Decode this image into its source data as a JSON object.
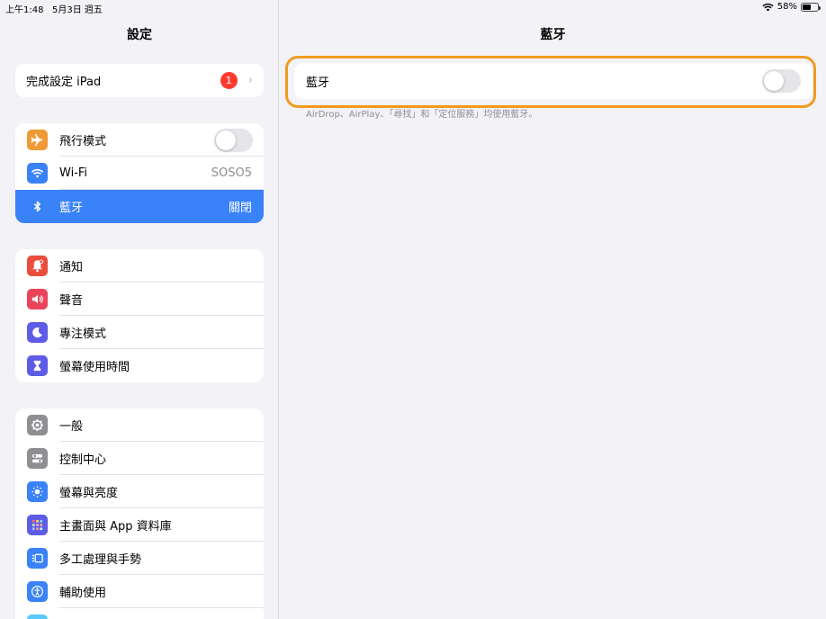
{
  "status": {
    "time": "上午1:48",
    "date": "5月3日 週五",
    "battery": "58%",
    "battery_level": 0.58
  },
  "sidebar": {
    "title": "設定",
    "setup": {
      "label": "完成設定 iPad",
      "badge": "1"
    },
    "group1": [
      {
        "label": "飛行模式",
        "icon": "airplane-icon",
        "color": "#f09a37",
        "control": "toggle",
        "on": false
      },
      {
        "label": "Wi-Fi",
        "icon": "wifi-icon",
        "color": "#3a82f7",
        "value": "SOSO5"
      },
      {
        "label": "藍牙",
        "icon": "bluetooth-icon",
        "color": "#3a82f7",
        "value": "關閉",
        "selected": true
      }
    ],
    "group2": [
      {
        "label": "通知",
        "icon": "notification-icon",
        "color": "#eb4d3d"
      },
      {
        "label": "聲音",
        "icon": "speaker-icon",
        "color": "#eb445a"
      },
      {
        "label": "專注模式",
        "icon": "moon-icon",
        "color": "#5e5ce6"
      },
      {
        "label": "螢幕使用時間",
        "icon": "hourglass-icon",
        "color": "#5e5ce6"
      }
    ],
    "group3": [
      {
        "label": "一般",
        "icon": "gear-icon",
        "color": "#8e8e93"
      },
      {
        "label": "控制中心",
        "icon": "switches-icon",
        "color": "#8e8e93"
      },
      {
        "label": "螢幕與亮度",
        "icon": "sun-icon",
        "color": "#3a82f7"
      },
      {
        "label": "主畫面與 App 資料庫",
        "icon": "app-grid-icon",
        "color": "#5e5ce6"
      },
      {
        "label": "多工處理與手勢",
        "icon": "multitask-icon",
        "color": "#3a82f7"
      },
      {
        "label": "輔助使用",
        "icon": "accessibility-icon",
        "color": "#3a82f7"
      }
    ]
  },
  "main": {
    "title": "藍牙",
    "bluetooth_label": "藍牙",
    "bluetooth_on": false,
    "footnote": "AirDrop、AirPlay、「尋找」和「定位服務」均使用藍牙。"
  },
  "colors": {
    "highlight": "#f29a1e",
    "selected": "#3a82f7"
  }
}
